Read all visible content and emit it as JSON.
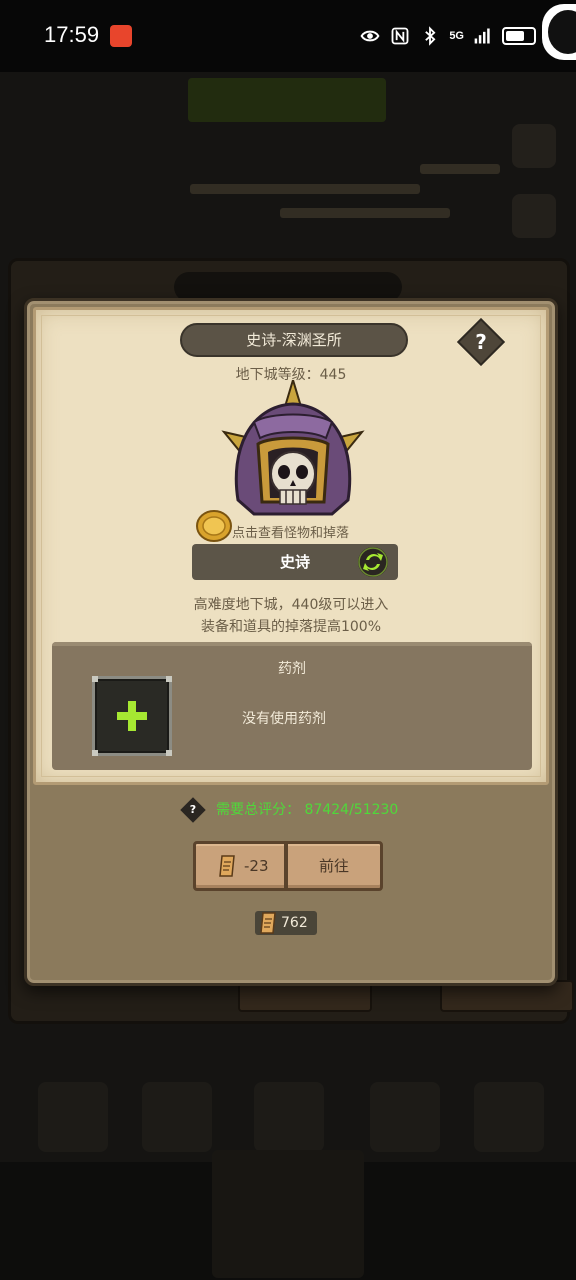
{
  "status_bar": {
    "time": "17:59",
    "network": "5G",
    "icons": [
      "eye-icon",
      "nfc-icon",
      "bluetooth-icon",
      "signal-icon",
      "battery-icon"
    ]
  },
  "dialog": {
    "title": "史诗-深渊圣所",
    "help_label": "?",
    "dungeon_level": "地下城等级：445",
    "boss_hint": "点击查看怪物和掉落",
    "difficulty": "史诗",
    "description_line1": "高难度地下城，440级可以进入",
    "description_line2": "装备和道具的掉落提高100%",
    "potion": {
      "title": "药剂",
      "status": "没有使用药剂"
    },
    "requirement": {
      "help_label": "?",
      "label": "需要总评分：",
      "value": "87424/51230"
    },
    "ticket_cost": "-23",
    "go_button": "前往",
    "ticket_balance": "762"
  },
  "colors": {
    "score_green": "#4fd93a",
    "plus_green": "#a6e832",
    "parchment": "#ede0c1"
  }
}
